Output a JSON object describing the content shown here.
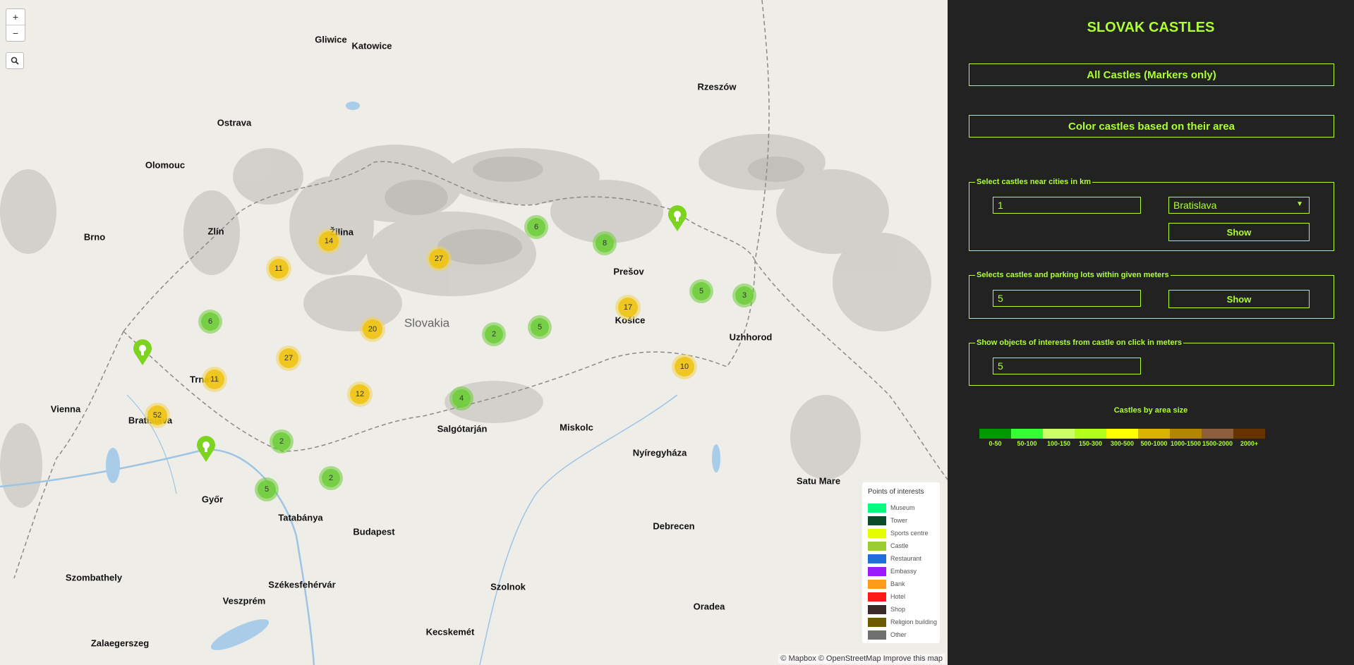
{
  "map": {
    "zoom_in_label": "+",
    "zoom_out_label": "−",
    "search_icon": "search-icon",
    "attribution": "© Mapbox © OpenStreetMap Improve this map",
    "region_label": "Slovakia",
    "cities_major": [
      "Ostrava",
      "Olomouc",
      "Brno",
      "Zlín",
      "Vienna",
      "Bratislava",
      "Trnava",
      "Žilina",
      "Košice",
      "Prešov",
      "Uzhhorod",
      "Miskolc",
      "Nyíregyháza",
      "Debrecen",
      "Budapest",
      "Győr",
      "Tatabánya",
      "Szombathely",
      "Székesfehérvár",
      "Veszprém",
      "Szolnok",
      "Kecskemét",
      "Salgótarján",
      "Oradea",
      "Satu Mare",
      "Rzeszów",
      "Katowice",
      "Gliwice",
      "Zalaegerszeg"
    ],
    "clusters": [
      {
        "count": "14",
        "kind": "medium"
      },
      {
        "count": "27",
        "kind": "medium"
      },
      {
        "count": "11",
        "kind": "medium"
      },
      {
        "count": "6",
        "kind": "small"
      },
      {
        "count": "8",
        "kind": "small"
      },
      {
        "count": "17",
        "kind": "medium"
      },
      {
        "count": "5",
        "kind": "small"
      },
      {
        "count": "3",
        "kind": "small"
      },
      {
        "count": "6",
        "kind": "small"
      },
      {
        "count": "20",
        "kind": "medium"
      },
      {
        "count": "2",
        "kind": "small"
      },
      {
        "count": "5",
        "kind": "small"
      },
      {
        "count": "27",
        "kind": "medium"
      },
      {
        "count": "11",
        "kind": "medium"
      },
      {
        "count": "12",
        "kind": "medium"
      },
      {
        "count": "4",
        "kind": "small"
      },
      {
        "count": "10",
        "kind": "medium"
      },
      {
        "count": "52",
        "kind": "medium"
      },
      {
        "count": "2",
        "kind": "small"
      },
      {
        "count": "2",
        "kind": "small"
      },
      {
        "count": "5",
        "kind": "small"
      }
    ],
    "poi_legend": {
      "title": "Points of interests",
      "items": [
        {
          "label": "Museum",
          "color": "#00ff7f"
        },
        {
          "label": "Tower",
          "color": "#0b4d2b"
        },
        {
          "label": "Sports centre",
          "color": "#e6ff00"
        },
        {
          "label": "Castle",
          "color": "#9acd32"
        },
        {
          "label": "Restaurant",
          "color": "#1e6fd9"
        },
        {
          "label": "Embassy",
          "color": "#9b1bff"
        },
        {
          "label": "Bank",
          "color": "#ff9a1a"
        },
        {
          "label": "Hotel",
          "color": "#ff1a1a"
        },
        {
          "label": "Shop",
          "color": "#3a2a2a"
        },
        {
          "label": "Religion building",
          "color": "#6b5a00"
        },
        {
          "label": "Other",
          "color": "#707070"
        }
      ]
    }
  },
  "panel": {
    "title": "SLOVAK CASTLES",
    "btn_all": "All Castles (Markers only)",
    "btn_color": "Color castles based on their area",
    "near_cities": {
      "legend": "Select castles near cities in km",
      "value": "1",
      "city": "Bratislava",
      "show": "Show"
    },
    "parking": {
      "legend": "Selects castles and parking lots within given meters",
      "value": "5",
      "show": "Show"
    },
    "poi": {
      "legend": "Show objects of interests from castle on click in meters",
      "value": "5"
    },
    "area_legend": {
      "title": "Castles by area size",
      "items": [
        {
          "label": "0-50",
          "color": "#009900"
        },
        {
          "label": "50-100",
          "color": "#33ff33"
        },
        {
          "label": "100-150",
          "color": "#ccff66"
        },
        {
          "label": "150-300",
          "color": "#b3ff1a"
        },
        {
          "label": "300-500",
          "color": "#ffff00"
        },
        {
          "label": "500-1000",
          "color": "#d9b300"
        },
        {
          "label": "1000-1500",
          "color": "#b38600"
        },
        {
          "label": "1500-2000",
          "color": "#8c5e3c"
        },
        {
          "label": "2000+",
          "color": "#663300"
        }
      ]
    }
  },
  "colors": {
    "accent": "#adff2f",
    "panel_bg": "#222222",
    "map_bg": "#efede8"
  }
}
